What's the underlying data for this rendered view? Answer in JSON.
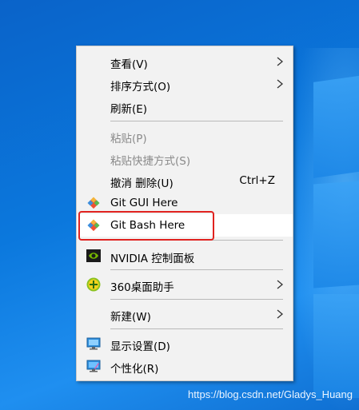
{
  "menu": {
    "items": [
      {
        "label": "查看(V)"
      },
      {
        "label": "排序方式(O)"
      },
      {
        "label": "刷新(E)"
      },
      {
        "label": "粘贴(P)"
      },
      {
        "label": "粘贴快捷方式(S)"
      },
      {
        "label": "撤消 删除(U)",
        "shortcut": "Ctrl+Z"
      },
      {
        "label": "Git GUI Here"
      },
      {
        "label": "Git Bash Here"
      },
      {
        "label": "NVIDIA 控制面板"
      },
      {
        "label": "360桌面助手"
      },
      {
        "label": "新建(W)"
      },
      {
        "label": "显示设置(D)"
      },
      {
        "label": "个性化(R)"
      }
    ]
  },
  "icons": {
    "git_gui": "git-diamond-icon",
    "git_bash": "git-diamond-icon",
    "nvidia": "nvidia-logo-icon",
    "assistant_360": "360-assistant-icon",
    "display": "monitor-icon",
    "personalize": "personalize-monitor-icon",
    "submenu": "chevron-right-icon"
  },
  "colors": {
    "highlight_box": "#e0221f",
    "menu_background": "#f2f2f2",
    "desktop": "#0b78dd"
  },
  "watermark": "https://blog.csdn.net/Gladys_Huang"
}
